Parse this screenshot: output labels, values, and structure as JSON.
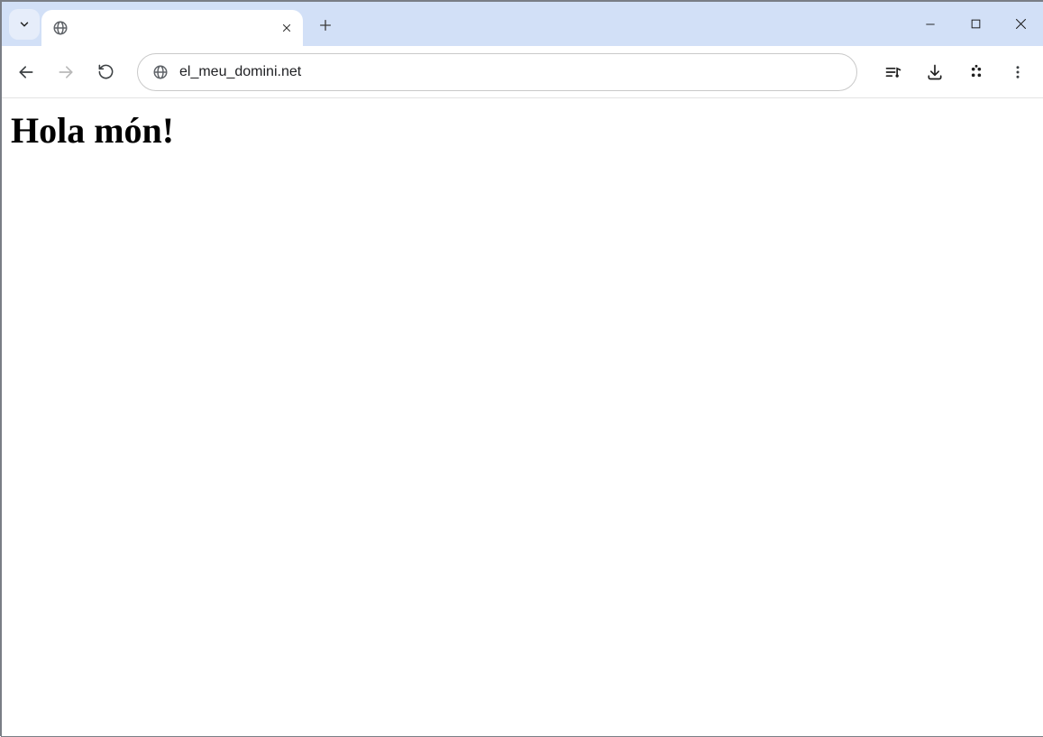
{
  "tabs": [
    {
      "title": "",
      "active": true
    }
  ],
  "address_bar": {
    "url": "el_meu_domini.net"
  },
  "page": {
    "heading": "Hola món!"
  }
}
